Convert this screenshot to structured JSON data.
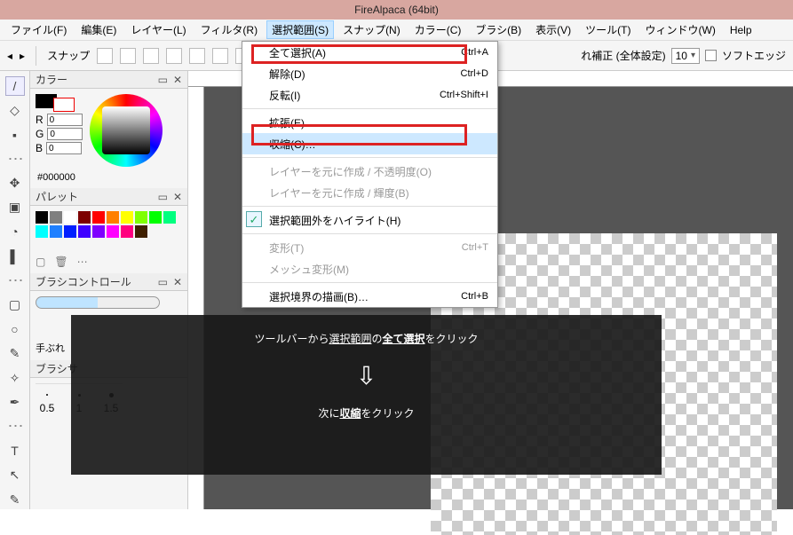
{
  "title": "FireAlpaca (64bit)",
  "menu": {
    "file": "ファイル(F)",
    "edit": "編集(E)",
    "layer": "レイヤー(L)",
    "filter": "フィルタ(R)",
    "select": "選択範囲(S)",
    "snap": "スナップ(N)",
    "color": "カラー(C)",
    "brush": "ブラシ(B)",
    "view": "表示(V)",
    "tool": "ツール(T)",
    "window": "ウィンドウ(W)",
    "help": "Help"
  },
  "toolbar": {
    "snap": "スナップ",
    "postlabel": "れ補正 (全体設定)",
    "num": "10",
    "softedge": "ソフトエッジ"
  },
  "panels": {
    "color": {
      "title": "カラー",
      "r": "R",
      "g": "G",
      "b": "B",
      "rv": "0",
      "gv": "0",
      "bv": "0",
      "hex": "#000000"
    },
    "palette": {
      "title": "パレット",
      "colors": [
        "#000000",
        "#7f7f7f",
        "#ffffff",
        "#7d0000",
        "#ff0000",
        "#ff7f00",
        "#ffff00",
        "#7fff00",
        "#00ff00",
        "#00ff7f",
        "#00ffff",
        "#1f80ff",
        "#001fff",
        "#3f00ff",
        "#7f00ff",
        "#ff00ff",
        "#ff007f",
        "#402000"
      ]
    },
    "brushctrl": {
      "title": "ブラシコントロール",
      "tebure": "手ぶれ"
    },
    "brushsize": {
      "title": "ブラシサ",
      "s": [
        "0.5",
        "1",
        "1.5"
      ]
    }
  },
  "dropdown": {
    "selectall": {
      "l": "全て選択(A)",
      "s": "Ctrl+A"
    },
    "deselect": {
      "l": "解除(D)",
      "s": "Ctrl+D"
    },
    "invert": {
      "l": "反転(I)",
      "s": "Ctrl+Shift+I"
    },
    "expand": {
      "l": "拡張(E)"
    },
    "contract": {
      "l": "収縮(C)…"
    },
    "layopa": {
      "l": "レイヤーを元に作成 / 不透明度(O)"
    },
    "laylum": {
      "l": "レイヤーを元に作成 / 輝度(B)"
    },
    "highlight": {
      "l": "選択範囲外をハイライト(H)"
    },
    "transform": {
      "l": "変形(T)",
      "s": "Ctrl+T"
    },
    "mesh": {
      "l": "メッシュ変形(M)"
    },
    "border": {
      "l": "選択境界の描画(B)…",
      "s": "Ctrl+B"
    }
  },
  "anno": {
    "l1a": "ツールバーから",
    "l1b": "選択範囲",
    "l1c": "の",
    "l1d": "全て選択",
    "l1e": "をクリック",
    "arrow": "⇩",
    "l2a": "次に",
    "l2b": "収縮",
    "l2c": "をクリック"
  }
}
